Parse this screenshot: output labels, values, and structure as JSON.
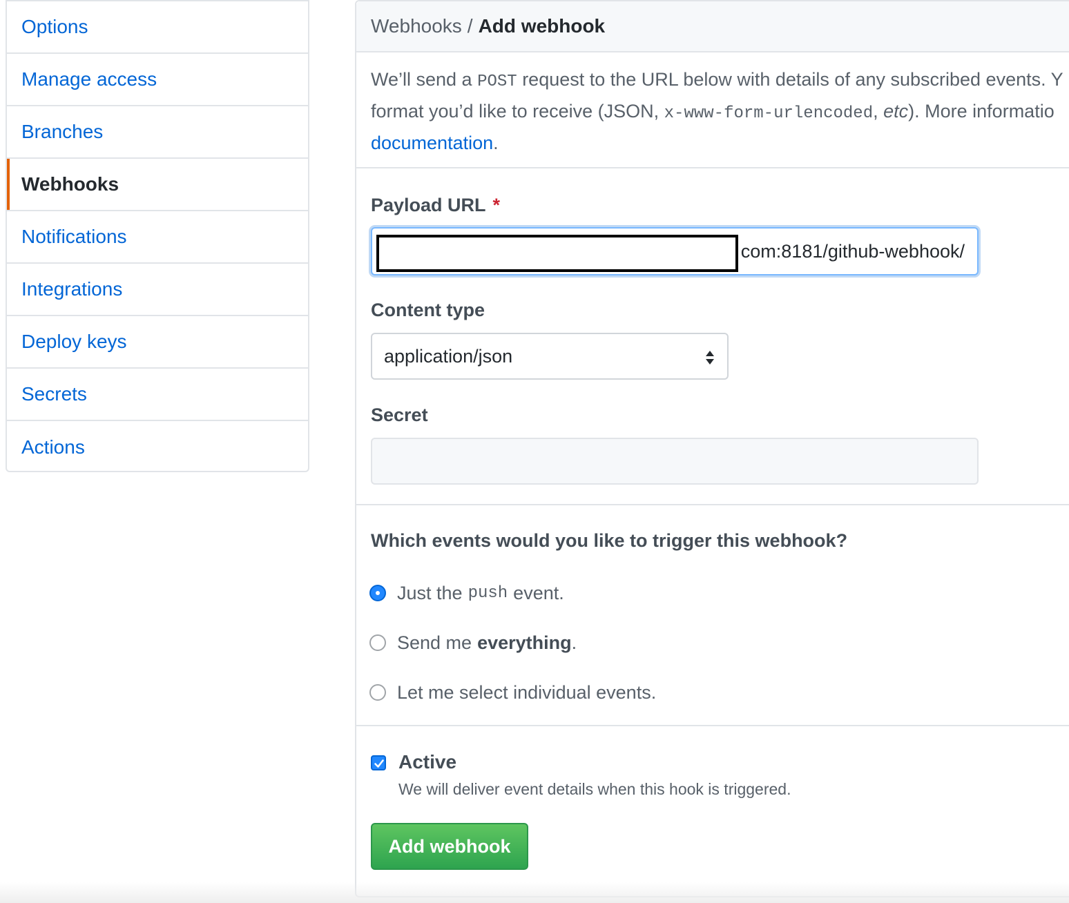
{
  "sidebar": {
    "items": [
      {
        "label": "Options"
      },
      {
        "label": "Manage access"
      },
      {
        "label": "Branches"
      },
      {
        "label": "Webhooks",
        "selected": true
      },
      {
        "label": "Notifications"
      },
      {
        "label": "Integrations"
      },
      {
        "label": "Deploy keys"
      },
      {
        "label": "Secrets"
      },
      {
        "label": "Actions"
      }
    ]
  },
  "header": {
    "breadcrumb_parent": "Webhooks",
    "breadcrumb_sep": "/",
    "title": "Add webhook"
  },
  "intro": {
    "line1_a": "We’ll send a ",
    "line1_code": "POST",
    "line1_b": " request to the URL below with details of any subscribed events. Y",
    "line2_a": "format you’d like to receive (JSON, ",
    "line2_code": "x-www-form-urlencoded",
    "line2_b": ", ",
    "line2_em": "etc",
    "line2_c": "). More informatio",
    "link": "documentation",
    "link_tail": "."
  },
  "form": {
    "payload_label": "Payload URL",
    "required_mark": "*",
    "payload_value_visible": "com:8181/github-webhook/",
    "content_type_label": "Content type",
    "content_type_value": "application/json",
    "secret_label": "Secret",
    "secret_value": ""
  },
  "events": {
    "question": "Which events would you like to trigger this webhook?",
    "opt1_a": "Just the",
    "opt1_code": "push",
    "opt1_b": "event.",
    "opt2_a": "Send me",
    "opt2_strong": "everything",
    "opt2_b": ".",
    "opt3": "Let me select individual events.",
    "selected": "push"
  },
  "active": {
    "label": "Active",
    "checked": true,
    "note": "We will deliver event details when this hook is triggered."
  },
  "submit_label": "Add webhook",
  "colors": {
    "link": "#0366d6",
    "selected_bar": "#e36209",
    "button_green": "#2ea44f",
    "focus_border": "#79b8ff"
  }
}
